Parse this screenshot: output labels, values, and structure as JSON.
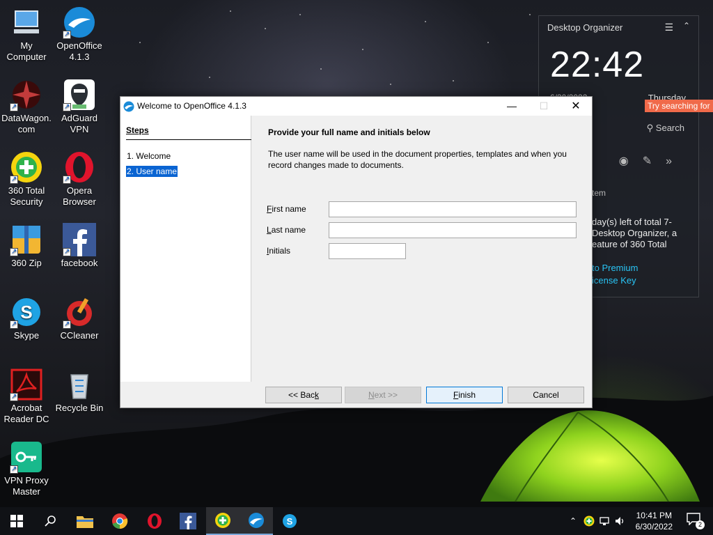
{
  "desktop": {
    "icons": [
      {
        "label_1": "My",
        "label_2": "Computer"
      },
      {
        "label_1": "OpenOffice",
        "label_2": "4.1.3"
      },
      {
        "label_1": "DataWagon.",
        "label_2": "com"
      },
      {
        "label_1": "AdGuard",
        "label_2": "VPN"
      },
      {
        "label_1": "360 Total",
        "label_2": "Security"
      },
      {
        "label_1": "Opera",
        "label_2": "Browser"
      },
      {
        "label_1": "360 Zip",
        "label_2": ""
      },
      {
        "label_1": "facebook",
        "label_2": ""
      },
      {
        "label_1": "Skype",
        "label_2": ""
      },
      {
        "label_1": "CCleaner",
        "label_2": ""
      },
      {
        "label_1": "Acrobat",
        "label_2": "Reader DC"
      },
      {
        "label_1": "Recycle Bin",
        "label_2": ""
      },
      {
        "label_1": "VPN Proxy",
        "label_2": "Master"
      }
    ]
  },
  "organizer": {
    "title": "Desktop Organizer",
    "time": "22:42",
    "date": "6/30/2022",
    "day": "Thursday",
    "tip": "Try searching for",
    "search": "Search",
    "text_partial": "tem",
    "message": "day(s) left of total 7-\n Desktop Organizer, a\neature of 360 Total",
    "link_premium": "to Premium",
    "link_license": "icense Key"
  },
  "dialog": {
    "title": "Welcome to OpenOffice 4.1.3",
    "steps_heading": "Steps",
    "steps": [
      "1. Welcome",
      "2. User name"
    ],
    "heading": "Provide your full name and initials below",
    "description": "The user name will be used in the document properties, templates and when you record changes made to documents.",
    "fields": {
      "first_name": {
        "label_access": "F",
        "label_rest": "irst name",
        "value": ""
      },
      "last_name": {
        "label_access": "L",
        "label_rest": "ast name",
        "value": ""
      },
      "initials": {
        "label_access": "I",
        "label_rest": "nitials",
        "value": ""
      }
    },
    "buttons": {
      "back_pre": "<< Bac",
      "back_access": "k",
      "next_access": "N",
      "next_rest": "ext >>",
      "finish_access": "F",
      "finish_rest": "inish",
      "cancel": "Cancel"
    }
  },
  "taskbar": {
    "time": "10:41 PM",
    "date": "6/30/2022",
    "notifications": "2"
  }
}
